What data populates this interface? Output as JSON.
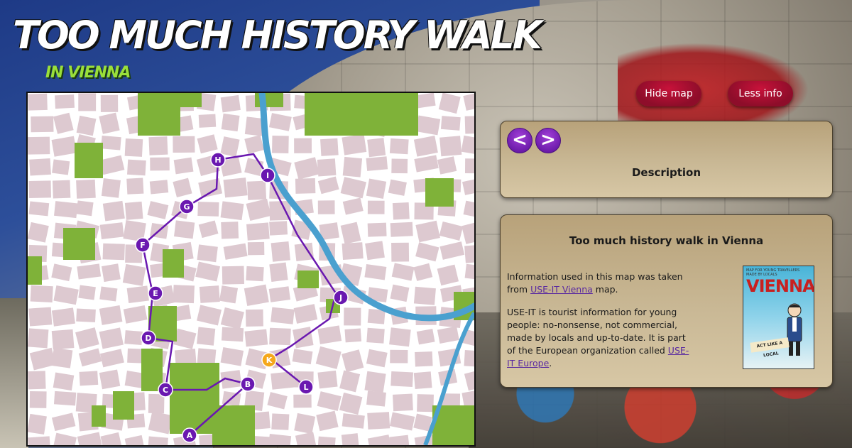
{
  "header": {
    "title": "TOO MUCH HISTORY WALK",
    "subtitle": "IN VIENNA"
  },
  "buttons": {
    "hide_map": "Hide map",
    "less_info": "Less info"
  },
  "nav": {
    "prev_label": "<",
    "next_label": ">",
    "heading": "Description"
  },
  "info": {
    "title": "Too much history walk in Vienna",
    "p1_before": "Information used in this map was taken from ",
    "p1_link": "USE-IT Vienna",
    "p1_after": " map.",
    "p2_before": "USE-IT is tourist information for young people: no-nonsense, not commercial, made by locals and up-to-date. It is part of the European organization called ",
    "p2_link": "USE-IT Europe",
    "p2_after": "."
  },
  "book": {
    "top_text": "MAP FOR YOUNG TRAVELLERS MADE BY LOCALS",
    "title": "VIENNA",
    "ribbon": "ACT LIKE A LOCAL"
  },
  "map": {
    "markers": [
      {
        "label": "A",
        "active": false
      },
      {
        "label": "B",
        "active": false
      },
      {
        "label": "C",
        "active": false
      },
      {
        "label": "D",
        "active": false
      },
      {
        "label": "E",
        "active": false
      },
      {
        "label": "F",
        "active": false
      },
      {
        "label": "G",
        "active": false
      },
      {
        "label": "H",
        "active": false
      },
      {
        "label": "I",
        "active": false
      },
      {
        "label": "J",
        "active": false
      },
      {
        "label": "K",
        "active": true
      },
      {
        "label": "L",
        "active": false
      }
    ],
    "colors": {
      "route": "#6a18b0",
      "marker": "#6a18b0",
      "marker_active": "#f5a81c",
      "block": "#ddc9d0",
      "park": "#7fb239",
      "river": "#4aa0cf"
    }
  },
  "colors": {
    "button": "#a0102e",
    "title_accent": "#9adf3a",
    "nav_arrow": "#7a28c0"
  }
}
